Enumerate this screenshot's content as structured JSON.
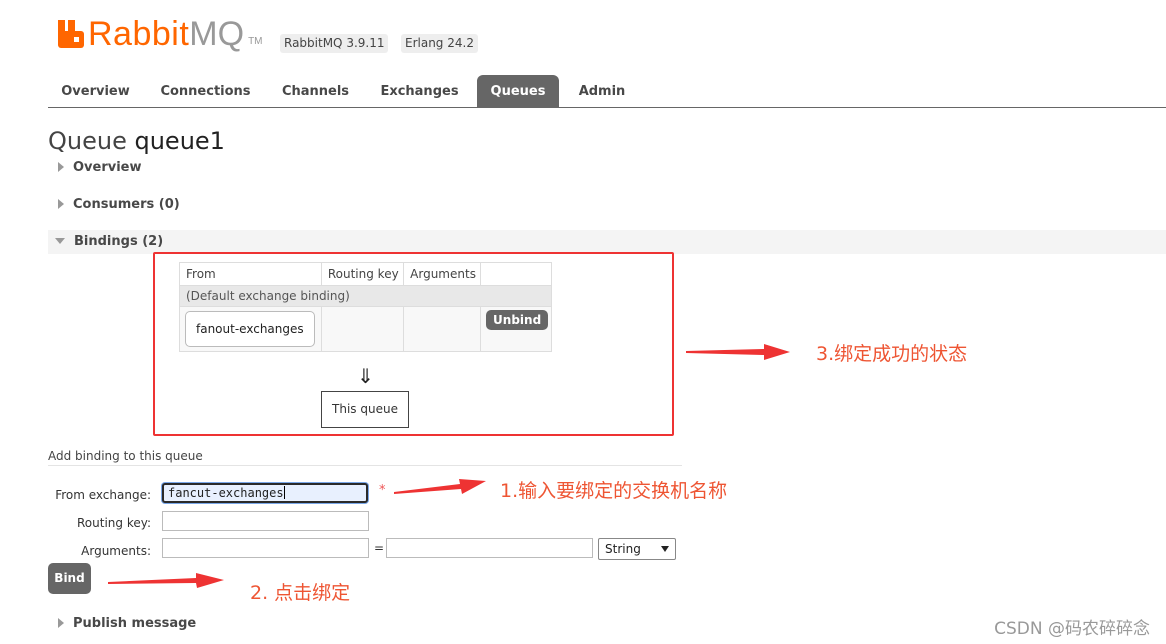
{
  "header": {
    "logo_primary": "Rabbit",
    "logo_secondary": "MQ",
    "logo_tm": "TM",
    "version_badge": "RabbitMQ 3.9.11",
    "erlang_badge": "Erlang 24.2"
  },
  "tabs": [
    {
      "label": "Overview"
    },
    {
      "label": "Connections"
    },
    {
      "label": "Channels"
    },
    {
      "label": "Exchanges"
    },
    {
      "label": "Queues",
      "active": true
    },
    {
      "label": "Admin"
    }
  ],
  "page": {
    "title_prefix": "Queue",
    "queue_name": "queue1"
  },
  "sections": {
    "overview": "Overview",
    "consumers": "Consumers (0)",
    "bindings": "Bindings (2)",
    "publish": "Publish message"
  },
  "bindings_table": {
    "headers": [
      "From",
      "Routing key",
      "Arguments",
      ""
    ],
    "default_row": "(Default exchange binding)",
    "rows": [
      {
        "from": "fanout-exchanges",
        "routing_key": "",
        "arguments": "",
        "action": "Unbind"
      }
    ],
    "arrow": "⇓",
    "this_queue": "This queue"
  },
  "add_binding": {
    "title": "Add binding to this queue",
    "from_exchange_label": "From exchange:",
    "from_exchange_value": "fancut-exchanges",
    "required_mark": "*",
    "routing_key_label": "Routing key:",
    "routing_key_value": "",
    "arguments_label": "Arguments:",
    "arg_key_value": "",
    "equals": "=",
    "arg_value": "",
    "type_selected": "String",
    "bind_button": "Bind"
  },
  "annotations": {
    "note_1": "1.输入要绑定的交换机名称",
    "note_2": "2. 点击绑定",
    "note_3": "3.绑定成功的状态",
    "color": "#e53"
  },
  "watermark": "CSDN @码农碎碎念",
  "colors": {
    "brand_orange": "#ff6600",
    "tab_active_bg": "#666666",
    "annotation_red": "#ee3333"
  }
}
